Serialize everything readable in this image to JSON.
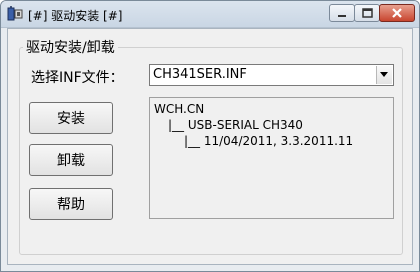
{
  "window": {
    "title": "[#] 驱动安装 [#]"
  },
  "group": {
    "legend": "驱动安装/卸载"
  },
  "inf_select": {
    "label": "选择INF文件：",
    "value": "CH341SER.INF"
  },
  "buttons": {
    "install": "安装",
    "uninstall": "卸载",
    "help": "帮助"
  },
  "driver_info": {
    "lines": [
      "WCH.CN",
      "|__ USB-SERIAL CH340",
      "|__ 11/04/2011, 3.3.2011.11"
    ]
  },
  "icons": {
    "app": "usb-driver-app-icon",
    "minimize": "minimize-icon",
    "maximize": "maximize-icon",
    "close": "close-icon",
    "dropdown": "chevron-down-icon"
  },
  "colors": {
    "close_button": "#c8452f",
    "titlebar": "#c9d6e4"
  }
}
